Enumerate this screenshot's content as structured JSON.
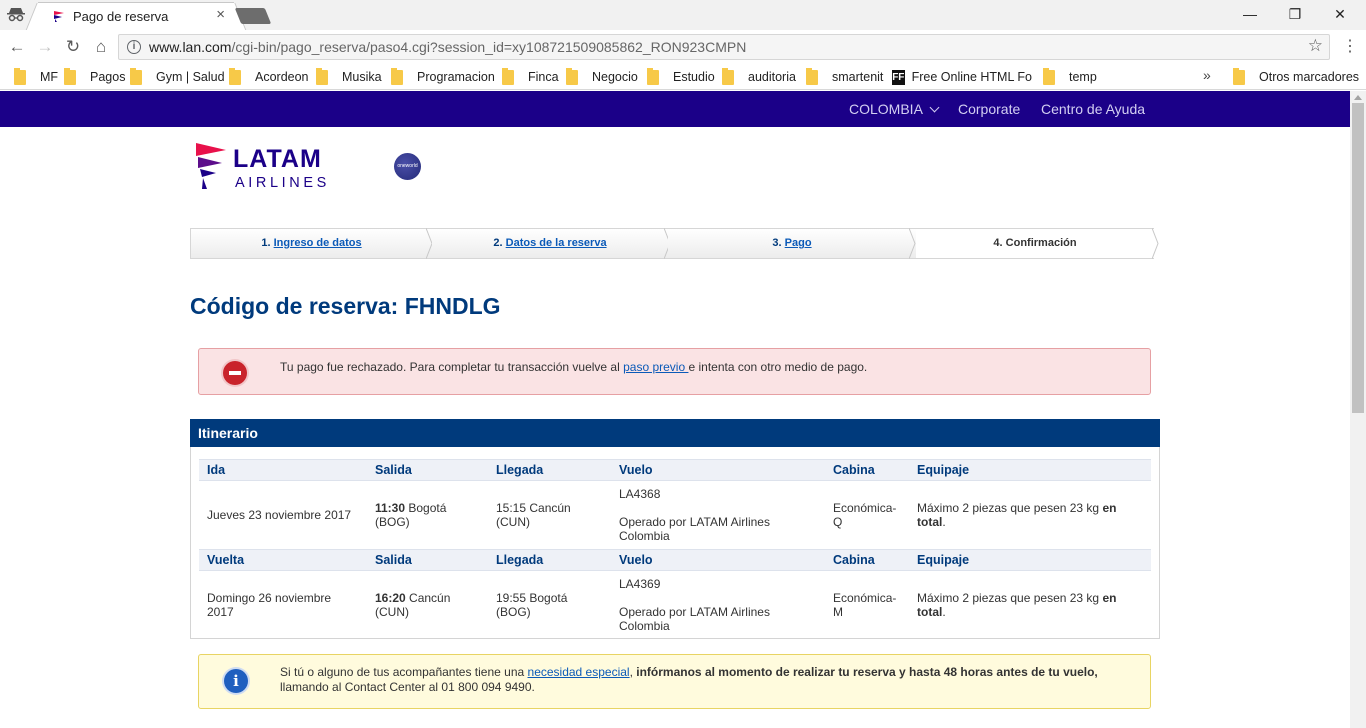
{
  "browser": {
    "tab_title": "Pago de reserva",
    "url_domain": "www.lan.com",
    "url_path": "/cgi-bin/pago_reserva/paso4.cgi?session_id=xy108721509085862_RON923CMPN",
    "bookmarks": [
      "MF",
      "Pagos",
      "Gym | Salud",
      "Acordeon",
      "Musika",
      "Programacion",
      "Finca",
      "Negocio",
      "Estudio",
      "auditoria",
      "smartenit",
      "Free Online HTML Fo",
      "temp",
      "Otros marcadores"
    ],
    "ff_label": "FF"
  },
  "topnav": {
    "country": "COLOMBIA",
    "corporate": "Corporate",
    "help": "Centro de Ayuda"
  },
  "logo": {
    "name": "LATAM",
    "sub": "AIRLINES",
    "partner": "oneworld"
  },
  "steps": [
    {
      "num": "1.",
      "label": "Ingreso de datos"
    },
    {
      "num": "2.",
      "label": "Datos de la reserva"
    },
    {
      "num": "3.",
      "label": "Pago"
    },
    {
      "num": "4.",
      "label": "Confirmación"
    }
  ],
  "reservation_title": "Código de reserva: FHNDLG",
  "error_alert": {
    "text_before": "Tu pago fue rechazado. Para completar tu transacción vuelve al ",
    "link": "paso previo ",
    "text_after": "e intenta con otro medio de pago."
  },
  "itinerary": {
    "title": "Itinerario",
    "columns": [
      "Salida",
      "Llegada",
      "Vuelo",
      "Cabina",
      "Equipaje"
    ],
    "legs": [
      {
        "label": "Ida",
        "date": "Jueves 23 noviembre 2017",
        "dep_time": "11:30",
        "dep_place": " Bogotá (BOG)",
        "arr": "15:15 Cancún (CUN)",
        "flight": "LA4368",
        "operated": "Operado por LATAM Airlines Colombia",
        "cabin": "Económica- Q",
        "baggage": "Máximo 2 piezas que pesen 23 kg ",
        "baggage_bold": "en total",
        "baggage_end": "."
      },
      {
        "label": "Vuelta",
        "date": "Domingo 26 noviembre 2017",
        "dep_time": "16:20",
        "dep_place": " Cancún (CUN)",
        "arr": "19:55 Bogotá (BOG)",
        "flight": "LA4369",
        "operated": "Operado por LATAM Airlines Colombia",
        "cabin": "Económica- M",
        "baggage": "Máximo 2 piezas que pesen 23 kg ",
        "baggage_bold": "en total",
        "baggage_end": "."
      }
    ]
  },
  "info_alert": {
    "text_before": "Si tú o alguno de tus acompañantes tiene una ",
    "link": "necesidad especial",
    "text_middle": ", ",
    "text_bold": "infórmanos al momento de realizar tu reserva y hasta 48 horas antes de tu vuelo,",
    "text_after": " llamando al Contact Center al 01 800 094 9490."
  },
  "colors": {
    "brand": "#1b0088",
    "heading": "#003a7c",
    "error": "#c9232b",
    "info": "#1f5fbf"
  }
}
